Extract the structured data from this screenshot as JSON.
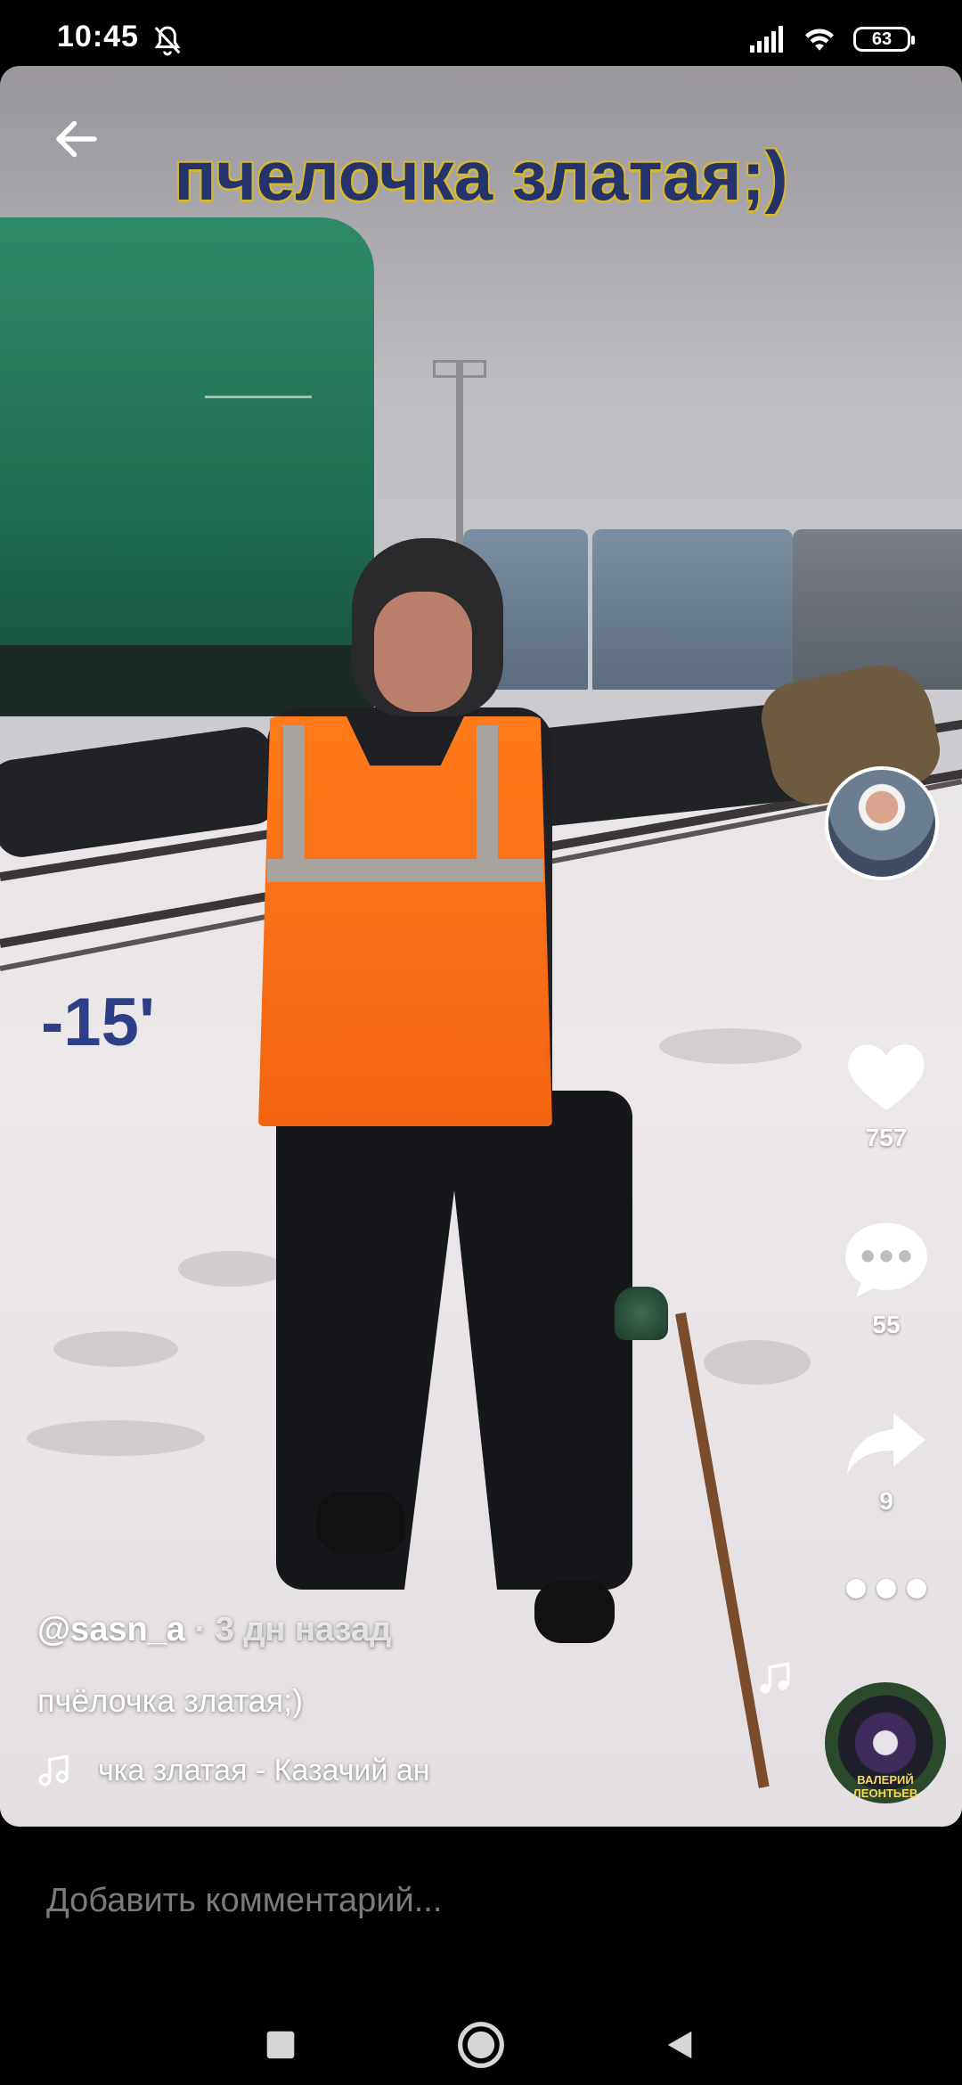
{
  "status_bar": {
    "time": "10:45",
    "battery": "63",
    "icons": [
      "bell-muted-icon",
      "signal-icon",
      "wifi-icon",
      "battery-icon"
    ]
  },
  "video": {
    "caption": "пчелочка златая;)",
    "temperature_label": "-15'"
  },
  "actions": {
    "likes": "757",
    "comments": "55",
    "shares": "9"
  },
  "post": {
    "author": "@sasn_a",
    "posted": " · 3 дн назад",
    "description": "пчёлочка златая;)",
    "music": "чка златая - Казачий ан",
    "disc_label": "ВАЛЕРИЙ ЛЕОНТЬЕВ"
  },
  "comment": {
    "placeholder": "Добавить комментарий..."
  },
  "colors": {
    "caption_text": "#24336b",
    "caption_outline": "#d6b830",
    "vest": "#f36412"
  }
}
